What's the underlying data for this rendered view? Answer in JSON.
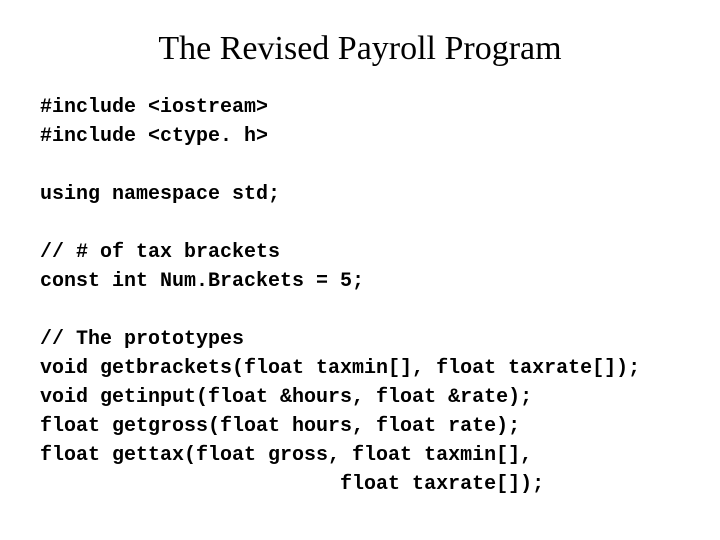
{
  "title": "The Revised Payroll Program",
  "code": {
    "l1": "#include <iostream>",
    "l2": "#include <ctype. h>",
    "l3": "",
    "l4": "using namespace std;",
    "l5": "",
    "l6": "// # of tax brackets",
    "l7": "const int Num.Brackets = 5;",
    "l8": "",
    "l9": "// The prototypes",
    "l10": "void getbrackets(float taxmin[], float taxrate[]);",
    "l11": "void getinput(float &hours, float &rate);",
    "l12": "float getgross(float hours, float rate);",
    "l13": "float gettax(float gross, float taxmin[],",
    "l14": "                         float taxrate[]);"
  }
}
